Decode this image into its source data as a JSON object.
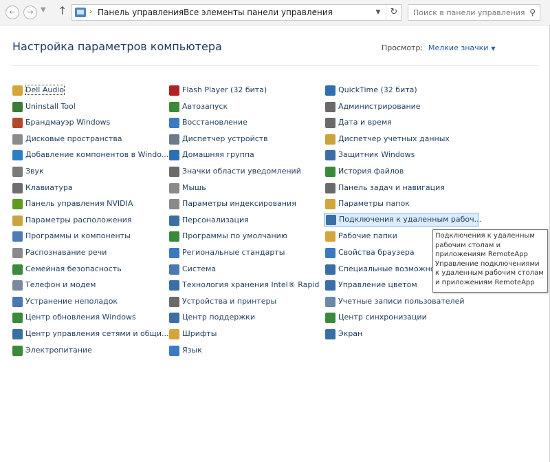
{
  "toolbar": {
    "back_icon": "back-arrow-icon",
    "forward_icon": "forward-arrow-icon",
    "up_icon": "up-arrow-icon",
    "breadcrumbs": [
      "Панель управления",
      "Все элементы панели управления"
    ],
    "search_placeholder": "Поиск в панели управления"
  },
  "header": {
    "title": "Настройка параметров компьютера",
    "view_label": "Просмотр:",
    "view_value": "Мелкие значки"
  },
  "columns": [
    [
      {
        "label": "Dell Audio",
        "icon": "speaker-icon",
        "color": "#d4a63a"
      },
      {
        "label": "Uninstall Tool",
        "icon": "uninstall-icon",
        "color": "#3b7a3b"
      },
      {
        "label": "Брандмауэр Windows",
        "icon": "firewall-icon",
        "color": "#b5472d"
      },
      {
        "label": "Дисковые пространства",
        "icon": "disk-icon",
        "color": "#8c8c8c"
      },
      {
        "label": "Добавление компонентов в Windo...",
        "icon": "windows-icon",
        "color": "#2d7ec4"
      },
      {
        "label": "Звук",
        "icon": "sound-icon",
        "color": "#7a7a7a"
      },
      {
        "label": "Клавиатура",
        "icon": "keyboard-icon",
        "color": "#6e6e6e"
      },
      {
        "label": "Панель управления NVIDIA",
        "icon": "nvidia-icon",
        "color": "#5e9a1e"
      },
      {
        "label": "Параметры расположения",
        "icon": "location-icon",
        "color": "#c9a33b"
      },
      {
        "label": "Программы и компоненты",
        "icon": "programs-icon",
        "color": "#4f7cb8"
      },
      {
        "label": "Распознавание речи",
        "icon": "microphone-icon",
        "color": "#8a8a8a"
      },
      {
        "label": "Семейная безопасность",
        "icon": "family-icon",
        "color": "#3c8a3c"
      },
      {
        "label": "Телефон и модем",
        "icon": "phone-icon",
        "color": "#7a8a9a"
      },
      {
        "label": "Устранение неполадок",
        "icon": "troubleshoot-icon",
        "color": "#4a78b0"
      },
      {
        "label": "Центр обновления Windows",
        "icon": "update-icon",
        "color": "#3b8a3b"
      },
      {
        "label": "Центр управления сетями и общи...",
        "icon": "network-icon",
        "color": "#3a6ea5"
      },
      {
        "label": "Электропитание",
        "icon": "power-icon",
        "color": "#3b8a3b"
      }
    ],
    [
      {
        "label": "Flash Player (32 бита)",
        "icon": "flash-icon",
        "color": "#b22222"
      },
      {
        "label": "Автозапуск",
        "icon": "autoplay-icon",
        "color": "#3b8a3b"
      },
      {
        "label": "Восстановление",
        "icon": "recovery-icon",
        "color": "#3a7ac0"
      },
      {
        "label": "Диспетчер устройств",
        "icon": "device-manager-icon",
        "color": "#6a7a8a"
      },
      {
        "label": "Домашняя группа",
        "icon": "homegroup-icon",
        "color": "#2d6fb5"
      },
      {
        "label": "Значки области уведомлений",
        "icon": "notification-icon",
        "color": "#6a6a6a"
      },
      {
        "label": "Мышь",
        "icon": "mouse-icon",
        "color": "#8a8a8a"
      },
      {
        "label": "Параметры индексирования",
        "icon": "indexing-icon",
        "color": "#8a8a8a"
      },
      {
        "label": "Персонализация",
        "icon": "personalization-icon",
        "color": "#3a6ea5"
      },
      {
        "label": "Программы по умолчанию",
        "icon": "default-programs-icon",
        "color": "#3b8a3b"
      },
      {
        "label": "Региональные стандарты",
        "icon": "region-icon",
        "color": "#3a7ac0"
      },
      {
        "label": "Система",
        "icon": "system-icon",
        "color": "#4a7ab0"
      },
      {
        "label": "Технология хранения Intel® Rapid",
        "icon": "intel-icon",
        "color": "#3a6ea5"
      },
      {
        "label": "Устройства и принтеры",
        "icon": "printer-icon",
        "color": "#6a6a6a"
      },
      {
        "label": "Центр поддержки",
        "icon": "flag-icon",
        "color": "#3a6ea5"
      },
      {
        "label": "Шрифты",
        "icon": "fonts-icon",
        "color": "#d4a63a"
      },
      {
        "label": "Язык",
        "icon": "language-icon",
        "color": "#3a7ac0"
      }
    ],
    [
      {
        "label": "QuickTime (32 бита)",
        "icon": "quicktime-icon",
        "color": "#2f6fb0"
      },
      {
        "label": "Администрирование",
        "icon": "admin-tools-icon",
        "color": "#6a6a6a"
      },
      {
        "label": "Дата и время",
        "icon": "clock-icon",
        "color": "#6a6a6a"
      },
      {
        "label": "Диспетчер учетных данных",
        "icon": "credentials-icon",
        "color": "#c9a33b"
      },
      {
        "label": "Защитник Windows",
        "icon": "defender-icon",
        "color": "#3a6ea5"
      },
      {
        "label": "История файлов",
        "icon": "file-history-icon",
        "color": "#3b8a3b"
      },
      {
        "label": "Панель задач и навигация",
        "icon": "taskbar-icon",
        "color": "#6a6a6a"
      },
      {
        "label": "Параметры папок",
        "icon": "folder-options-icon",
        "color": "#d4a63a"
      },
      {
        "label": "Подключения к удаленным рабоч...",
        "icon": "remoteapp-icon",
        "color": "#3a6ea5"
      },
      {
        "label": "Рабочие папки",
        "icon": "work-folders-icon",
        "color": "#d4a63a"
      },
      {
        "label": "Свойства браузера",
        "icon": "browser-icon",
        "color": "#3a7ac0"
      },
      {
        "label": "Специальные возможности",
        "icon": "accessibility-icon",
        "color": "#3a6ea5"
      },
      {
        "label": "Управление цветом",
        "icon": "color-management-icon",
        "color": "#3a6ea5"
      },
      {
        "label": "Учетные записи пользователей",
        "icon": "users-icon",
        "color": "#6a8aa5"
      },
      {
        "label": "Центр синхронизации",
        "icon": "sync-icon",
        "color": "#3b8a3b"
      },
      {
        "label": "Экран",
        "icon": "display-icon",
        "color": "#3a6ea5"
      }
    ]
  ],
  "tooltip": {
    "title": "Подключения к удаленным рабочим столам и приложениям RemoteApp",
    "description": "Управление подключениями к удаленным рабочим столам и приложениям RemoteApp"
  },
  "colors": {
    "link": "#1f5aa7",
    "title": "#1e3a5f",
    "hover_bg": "#dcecfc",
    "hover_border": "#7eb4ea"
  }
}
